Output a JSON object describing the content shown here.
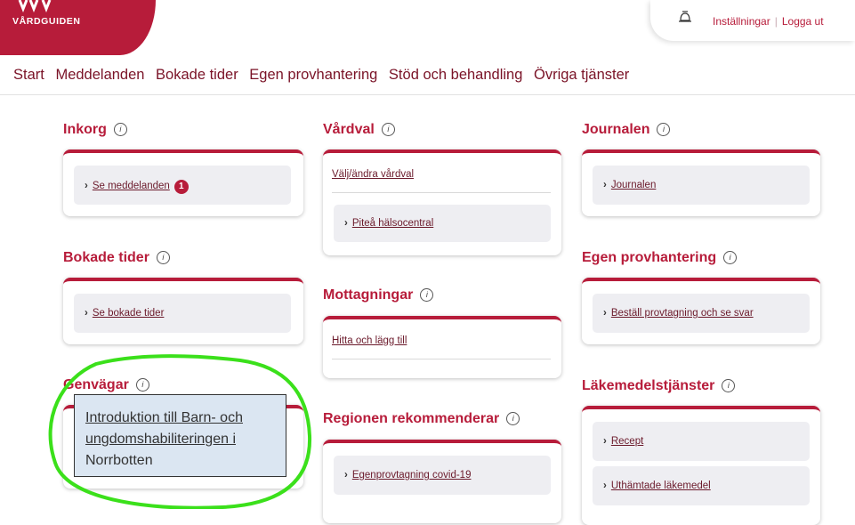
{
  "header": {
    "logo_text": "VÅRDGUIDEN",
    "settings_link": "Inställningar",
    "separator": "|",
    "logout_link": "Logga ut"
  },
  "nav": [
    "Start",
    "Meddelanden",
    "Bokade tider",
    "Egen provhantering",
    "Stöd och behandling",
    "Övriga tjänster"
  ],
  "sections": {
    "inkorg": {
      "title": "Inkorg",
      "item": "Se meddelanden",
      "badge": "1"
    },
    "bokade": {
      "title": "Bokade tider",
      "item": "Se bokade tider"
    },
    "genvagar": {
      "title": "Genvägar"
    },
    "vardval": {
      "title": "Vårdval",
      "link": "Välj/ändra vårdval",
      "item": "Piteå hälsocentral"
    },
    "mottagningar": {
      "title": "Mottagningar",
      "link": "Hitta och lägg till"
    },
    "regionen": {
      "title": "Regionen rekommenderar",
      "item": "Egenprovtagning covid-19"
    },
    "journalen": {
      "title": "Journalen",
      "item": "Journalen"
    },
    "egen": {
      "title": "Egen provhantering",
      "item": "Beställ provtagning och se svar"
    },
    "lakemedel": {
      "title": "Läkemedelstjänster",
      "items": [
        "Recept",
        "Uthämtade läkemedel"
      ]
    }
  },
  "tooltip": {
    "line1": "Introduktion till Barn- och",
    "line2": "ungdomshabiliteringen i",
    "line3": "Norrbotten"
  },
  "colors": {
    "brand": "#b71c3a",
    "annotation": "#3be01b",
    "tooltip_bg": "#dbe6f2"
  },
  "icons": {
    "logo": "vardguiden-logo",
    "notification": "bell-icon",
    "info": "info-icon",
    "chevron": "chevron-right-icon"
  }
}
